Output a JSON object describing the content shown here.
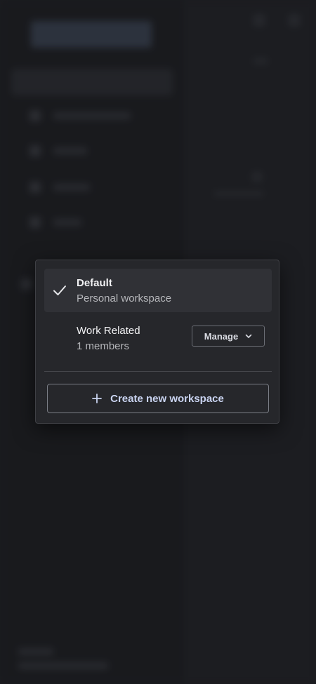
{
  "workspaces": [
    {
      "name": "Default",
      "subtitle": "Personal workspace",
      "selected": true
    },
    {
      "name": "Work Related",
      "subtitle": "1 members",
      "selected": false,
      "manage_label": "Manage"
    }
  ],
  "create_label": "Create new workspace",
  "colors": {
    "background": "#1b1c20",
    "popover": "#26272b",
    "selected_row": "#303136",
    "accent_text": "#c9d3f0"
  },
  "icons": {
    "selected": "check-icon",
    "manage": "chevron-down-icon",
    "create": "plus-icon"
  }
}
